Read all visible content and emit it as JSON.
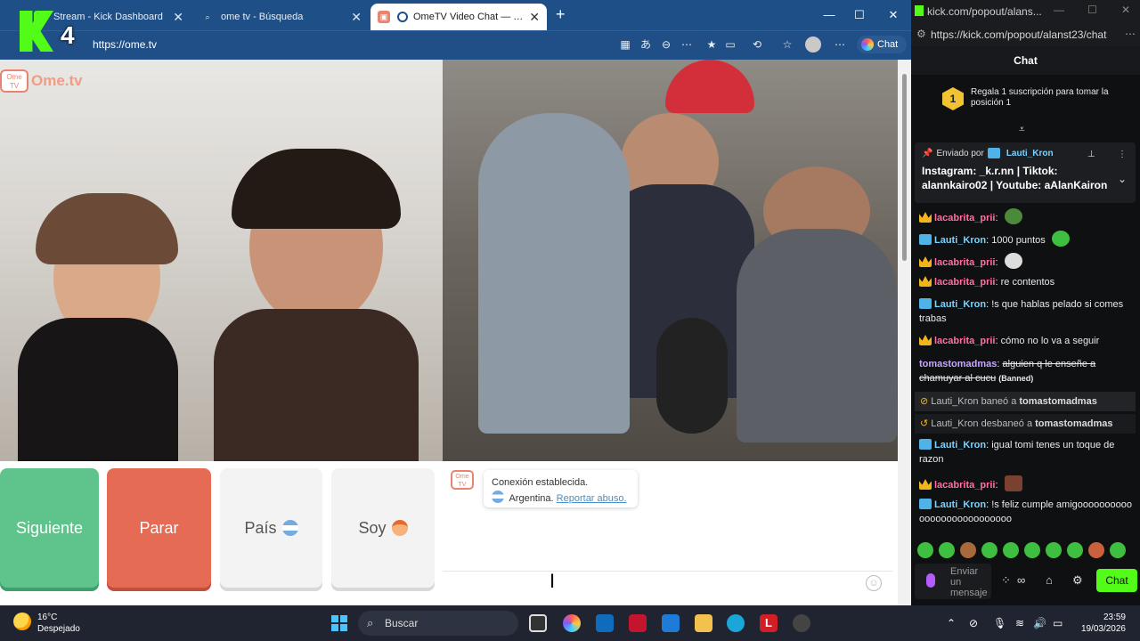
{
  "tabs": [
    {
      "title": "Stream - Kick Dashboard",
      "active": false
    },
    {
      "title": "ome tv - Búsqueda",
      "active": false
    },
    {
      "title": "OmeTV Video Chat — Omegle",
      "active": true
    }
  ],
  "browser": {
    "url": "https://ome.tv",
    "chat_label": "Chat",
    "new_tab": "+"
  },
  "overlay": {
    "kick_number": "4"
  },
  "ome": {
    "logo_tv": "Ome TV",
    "logo_text": "Ome.tv",
    "btn_next": "Siguiente",
    "btn_stop": "Parar",
    "btn_country": "País",
    "btn_gender": "Soy",
    "msg_tv": "Ome TV",
    "conn_status": "Conexión establecida.",
    "conn_country": "Argentina.",
    "report_link": "Reportar abuso."
  },
  "kick": {
    "window_title": "kick.com/popout/alans...",
    "url": "https://kick.com/popout/alanst23/chat",
    "header": "Chat",
    "sub_rank": "1",
    "sub_text": "Regala 1 suscripción para tomar la posición 1",
    "pinned_by": "Enviado por",
    "pinned_user": "Lauti_Kron",
    "pinned_text": "Instagram: _k.r.nn | Tiktok: alannkairo02 | Youtube: aAlanKairon",
    "messages": [
      {
        "user": "lacabrita_prii",
        "text": ""
      },
      {
        "user": "Lauti_Kron",
        "text": "1000 puntos"
      },
      {
        "user": "lacabrita_prii",
        "text": ""
      },
      {
        "user": "lacabrita_prii",
        "text": "re contentos"
      },
      {
        "user": "Lauti_Kron",
        "text": "!s que hablas pelado si comes trabas"
      },
      {
        "user": "lacabrita_prii",
        "text": "cómo no lo va a seguir"
      },
      {
        "user": "tomastomadmas",
        "text": "alguien q le enseñe a chamuyar al cucu",
        "tag": "(Banned)"
      },
      {
        "user": "Lauti_Kron",
        "text": "igual tomi tenes un toque de razon"
      },
      {
        "user": "lacabrita_prii",
        "text": ""
      },
      {
        "user": "Lauti_Kron",
        "text": "!s feliz cumple amigooooooooooooooooooooooooooo"
      }
    ],
    "sys_ban": {
      "actor": "Lauti_Kron",
      "verb": "baneó a",
      "target": "tomastomadmas"
    },
    "sys_unban": {
      "actor": "Lauti_Kron",
      "verb": "desbaneó a",
      "target": "tomastomadmas"
    },
    "input_placeholder": "Enviar un mensaje",
    "chat_button": "Chat"
  },
  "taskbar": {
    "temp": "16°C",
    "weather": "Despejado",
    "search": "Buscar",
    "time": "23:59",
    "date": "19/03/2026"
  },
  "colors": {
    "kick_green": "#53fc18",
    "next_green": "#5fc48b",
    "stop_red": "#e66b55",
    "edge_blue": "#1e4f86"
  }
}
